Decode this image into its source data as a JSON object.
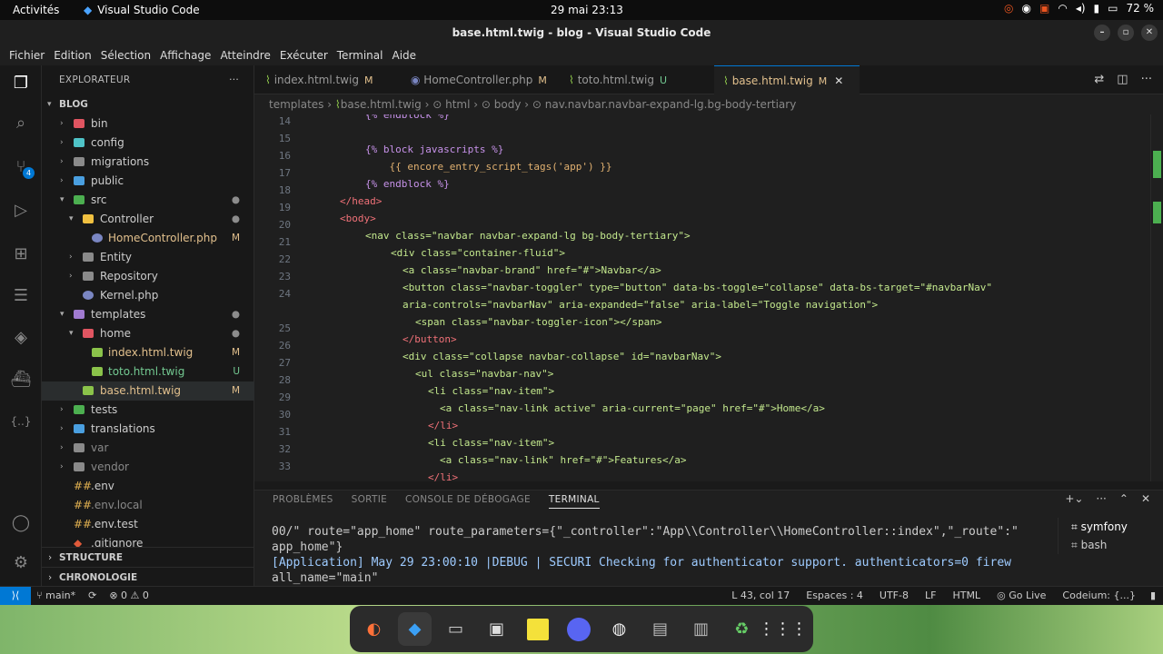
{
  "topbar": {
    "activities": "Activités",
    "app_name": "Visual Studio Code",
    "clock": "29 mai  23:13",
    "battery": "72 %"
  },
  "window": {
    "title": "base.html.twig - blog - Visual Studio Code"
  },
  "menu": [
    "Fichier",
    "Edition",
    "Sélection",
    "Affichage",
    "Atteindre",
    "Exécuter",
    "Terminal",
    "Aide"
  ],
  "activity": {
    "badge": "4"
  },
  "explorer": {
    "header": "EXPLORATEUR",
    "project": "BLOG",
    "items": [
      "bin",
      "config",
      "migrations",
      "public",
      "src",
      "Controller",
      "HomeController.php",
      "Entity",
      "Repository",
      "Kernel.php",
      "templates",
      "home",
      "index.html.twig",
      "toto.html.twig",
      "base.html.twig",
      "tests",
      "translations",
      "var",
      "vendor",
      ".env",
      ".env.local",
      ".env.test",
      ".gitignore"
    ],
    "status": {
      "m": "M",
      "u": "U"
    },
    "sections": [
      "STRUCTURE",
      "CHRONOLOGIE"
    ]
  },
  "tabs": [
    {
      "label": "index.html.twig",
      "status": "M"
    },
    {
      "label": "HomeController.php",
      "status": "M"
    },
    {
      "label": "toto.html.twig",
      "status": "U"
    },
    {
      "label": "base.html.twig",
      "status": "M"
    }
  ],
  "breadcrumb": [
    "templates",
    "base.html.twig",
    "html",
    "body",
    "nav.navbar.navbar-expand-lg.bg-body-tertiary"
  ],
  "code": {
    "line_numbers": [
      "14",
      "15",
      "16",
      "17",
      "18",
      "19",
      "20",
      "21",
      "22",
      "23",
      "24",
      "25",
      "26",
      "27",
      "28",
      "29",
      "30",
      "31",
      "32",
      "33"
    ],
    "lines": [
      "{% endblock %}",
      "",
      "{% block javascripts %}",
      "    {{ encore_entry_script_tags('app') }}",
      "{% endblock %}",
      "</head>",
      "<body>",
      "<nav class=\"navbar navbar-expand-lg bg-body-tertiary\">",
      "<div class=\"container-fluid\">",
      "<a class=\"navbar-brand\" href=\"#\">Navbar</a>",
      "<button class=\"navbar-toggler\" type=\"button\" data-bs-toggle=\"collapse\" data-bs-target=\"#navbarNav\"",
      "aria-controls=\"navbarNav\" aria-expanded=\"false\" aria-label=\"Toggle navigation\">",
      "<span class=\"navbar-toggler-icon\"></span>",
      "</button>",
      "<div class=\"collapse navbar-collapse\" id=\"navbarNav\">",
      "<ul class=\"navbar-nav\">",
      "<li class=\"nav-item\">",
      "<a class=\"nav-link active\" aria-current=\"page\" href=\"#\">Home</a>",
      "</li>",
      "<li class=\"nav-item\">",
      "<a class=\"nav-link\" href=\"#\">Features</a>",
      "</li>"
    ]
  },
  "panel": {
    "tabs": [
      "PROBLÈMES",
      "SORTIE",
      "CONSOLE DE DÉBOGAGE",
      "TERMINAL"
    ],
    "terminal_lines": [
      "00/\" route=\"app_home\" route_parameters={\"_controller\":\"App\\\\Controller\\\\HomeController::index\",\"_route\":\"",
      "app_home\"}",
      "[Application] May 29 23:00:10 |DEBUG  | SECURI Checking for authenticator support. authenticators=0 firew",
      "all_name=\"main\""
    ],
    "terminals": [
      "symfony",
      "bash"
    ]
  },
  "status": {
    "branch": "main*",
    "errors": "⊗ 0 ⚠ 0",
    "position": "L 43, col 17",
    "spaces": "Espaces : 4",
    "encoding": "UTF-8",
    "eol": "LF",
    "language": "HTML",
    "golive": "Go Live",
    "codeium": "Codeium: {...}"
  }
}
